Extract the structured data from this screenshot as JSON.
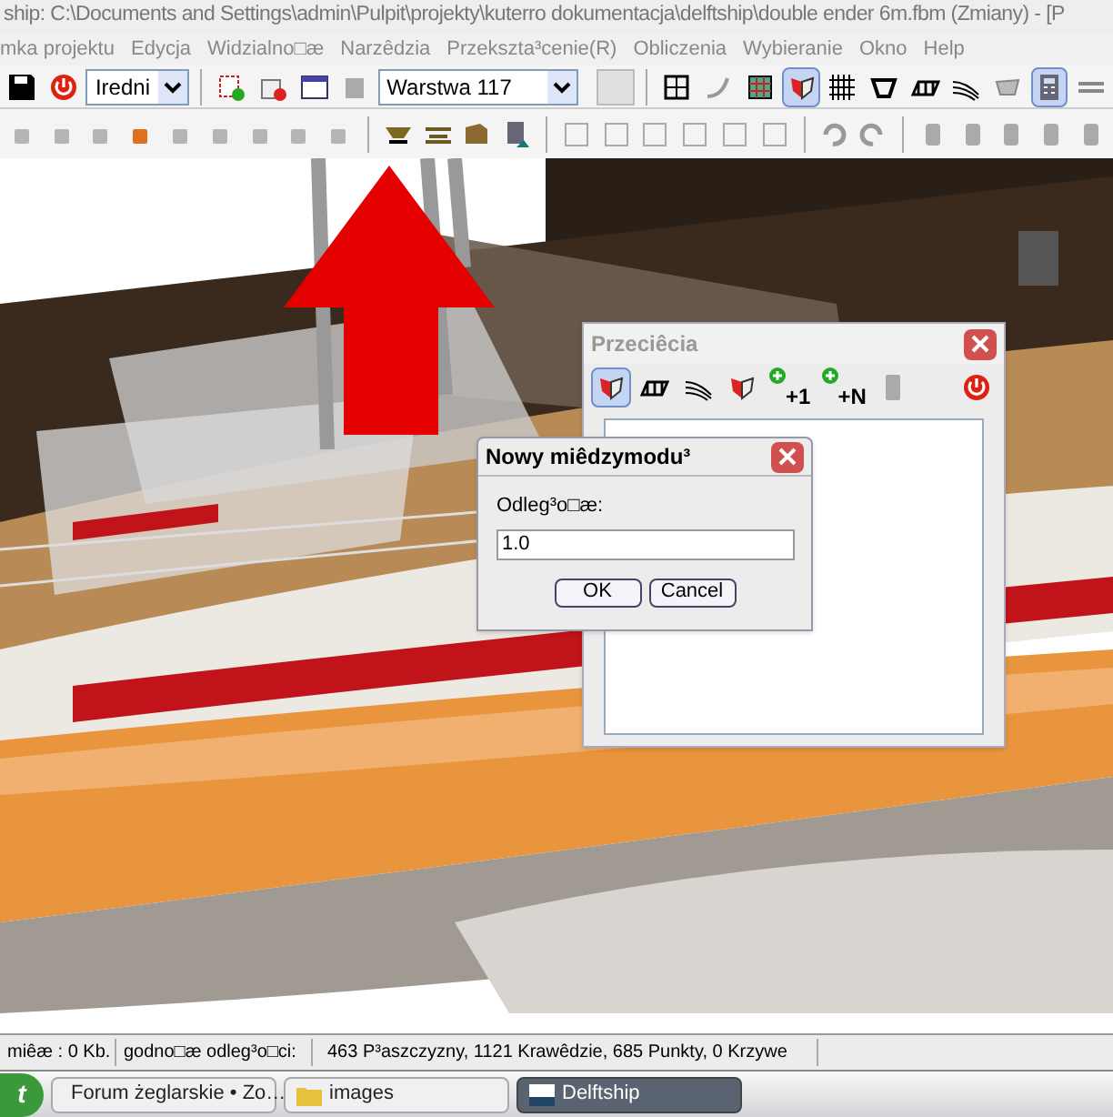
{
  "window": {
    "title": "ship: C:\\Documents and Settings\\admin\\Pulpit\\projekty\\kuterro dokumentacja\\delftship\\double ender 6m.fbm (Zmiany) - [P"
  },
  "menu": [
    "mka projektu",
    "Edycja",
    "Widzialno□æ",
    "Narzêdzia",
    "Przekszta³cenie(R)",
    "Obliczenia",
    "Wybieranie",
    "Okno",
    "Help"
  ],
  "toolbar_1": {
    "precision_combo": "Iredni",
    "layer_combo": "Warstwa 117",
    "view_buttons": [
      {
        "selected": false
      },
      {
        "selected": false
      },
      {
        "selected": false
      },
      {
        "selected": true
      },
      {
        "selected": false
      },
      {
        "selected": false
      },
      {
        "selected": false
      },
      {
        "selected": false
      },
      {
        "selected": false
      },
      {
        "selected": true
      },
      {
        "selected": false
      }
    ]
  },
  "sections_dialog": {
    "title": "Przeciêcia",
    "tools": [
      {
        "kind": "icon",
        "selected": true
      },
      {
        "kind": "icon",
        "selected": false
      },
      {
        "kind": "icon",
        "selected": false
      },
      {
        "kind": "icon",
        "selected": false
      },
      {
        "kind": "add",
        "label": "+1",
        "selected": false
      },
      {
        "kind": "add",
        "label": "+N",
        "selected": false
      },
      {
        "kind": "disabled",
        "selected": false
      },
      {
        "kind": "power",
        "selected": false
      }
    ]
  },
  "new_station_dialog": {
    "title": "Nowy miêdzymodu³",
    "field_label": "Odleg³o□æ:",
    "value": "1.0",
    "buttons": [
      "OK",
      "Cancel"
    ]
  },
  "status_bar": [
    "miêæ : 0 Kb.",
    "godno□æ odleg³o□ci:",
    "463 P³aszczyzny, 1121 Krawêdzie, 685 Punkty, 0 Krzywe"
  ],
  "taskbar": {
    "start": "t",
    "tasks": [
      {
        "label": "Forum żeglarskie • Zo…",
        "selected": false,
        "kind": "browser"
      },
      {
        "label": "images",
        "selected": false,
        "kind": "folder"
      },
      {
        "label": "Delftship",
        "selected": true,
        "kind": "app"
      }
    ]
  }
}
